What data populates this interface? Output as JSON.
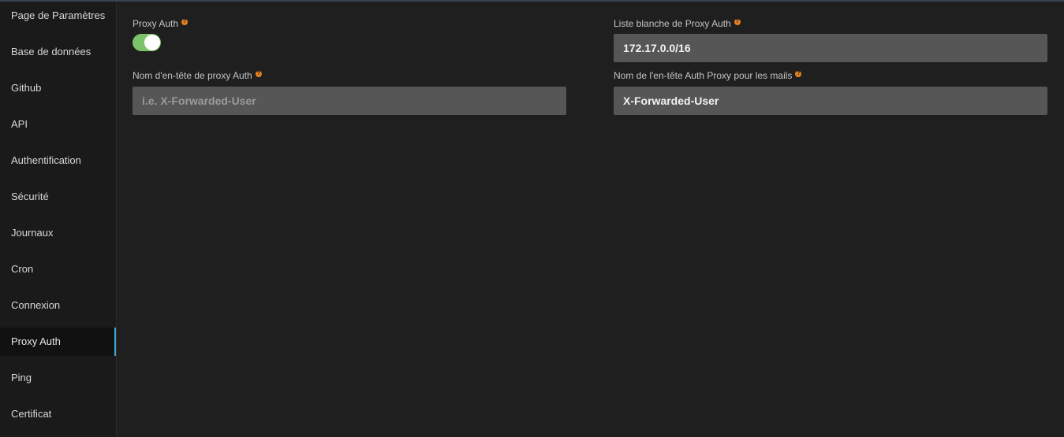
{
  "sidebar": {
    "items": [
      {
        "label": "Page de Paramètres"
      },
      {
        "label": "Base de données"
      },
      {
        "label": "Github"
      },
      {
        "label": "API"
      },
      {
        "label": "Authentification"
      },
      {
        "label": "Sécurité"
      },
      {
        "label": "Journaux"
      },
      {
        "label": "Cron"
      },
      {
        "label": "Connexion"
      },
      {
        "label": "Proxy Auth",
        "active": true
      },
      {
        "label": "Ping"
      },
      {
        "label": "Certificat"
      }
    ]
  },
  "form": {
    "proxy_auth": {
      "label": "Proxy Auth",
      "enabled": true
    },
    "whitelist": {
      "label": "Liste blanche de Proxy Auth",
      "value": "172.17.0.0/16"
    },
    "header_name": {
      "label": "Nom d'en-tête de proxy Auth",
      "value": "",
      "placeholder": "i.e. X-Forwarded-User"
    },
    "mail_header_name": {
      "label": "Nom de l'en-tête Auth Proxy pour les mails",
      "value": "X-Forwarded-User"
    },
    "help_glyph": "?"
  },
  "colors": {
    "toggle_on": "#7cc46a",
    "help_icon": "#e8801e",
    "active_indicator": "#3da9d8"
  }
}
